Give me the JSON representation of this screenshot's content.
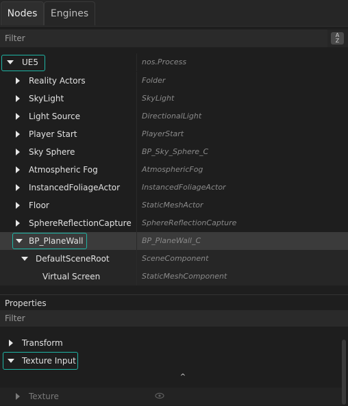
{
  "tabs": [
    {
      "label": "Nodes",
      "active": true
    },
    {
      "label": "Engines",
      "active": false
    }
  ],
  "nodes_filter": {
    "placeholder": "Filter",
    "sort_icon": "sort-alpha-icon",
    "sort_glyph_top": "A",
    "sort_glyph_bottom": "Z"
  },
  "tree": {
    "root": {
      "name": "UE5",
      "type": "nos.Process"
    },
    "items": [
      {
        "name": "Reality Actors",
        "type": "Folder"
      },
      {
        "name": "SkyLight",
        "type": "SkyLight"
      },
      {
        "name": "Light Source",
        "type": "DirectionalLight"
      },
      {
        "name": "Player Start",
        "type": "PlayerStart"
      },
      {
        "name": "Sky Sphere",
        "type": "BP_Sky_Sphere_C"
      },
      {
        "name": "Atmospheric Fog",
        "type": "AtmosphericFog"
      },
      {
        "name": "InstancedFoliageActor",
        "type": "InstancedFoliageActor"
      },
      {
        "name": "Floor",
        "type": "StaticMeshActor"
      },
      {
        "name": "SphereReflectionCapture",
        "type": "SphereReflectionCapture"
      },
      {
        "name": "BP_PlaneWall",
        "type": "BP_PlaneWall_C"
      },
      {
        "name": "DefaultSceneRoot",
        "type": "SceneComponent"
      },
      {
        "name": "Virtual Screen",
        "type": "StaticMeshComponent"
      }
    ]
  },
  "properties": {
    "title": "Properties",
    "filter_placeholder": "Filter",
    "items": [
      {
        "name": "Transform"
      },
      {
        "name": "Texture Input"
      },
      {
        "name": "Texture"
      }
    ]
  },
  "colors": {
    "accent": "#1fb6a6",
    "background": "#1e1e1e",
    "selected_row": "#3b3b3b"
  }
}
